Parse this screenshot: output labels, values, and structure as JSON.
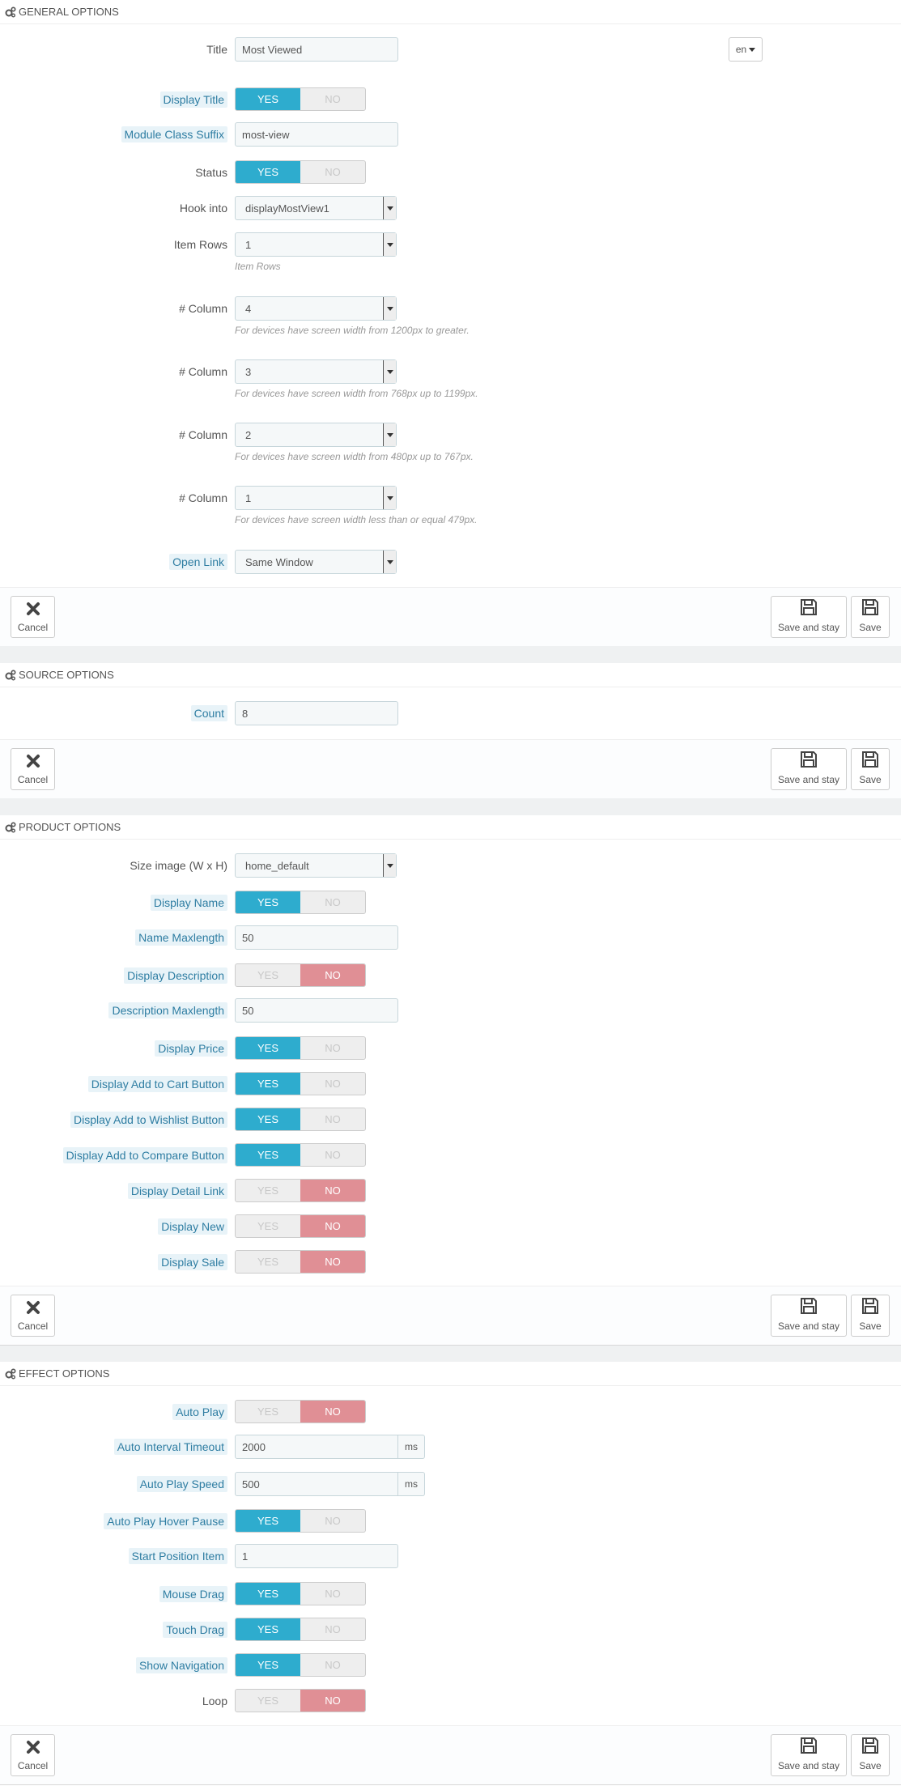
{
  "footer": {
    "cancel": "Cancel",
    "save_and_stay": "Save and stay",
    "save": "Save"
  },
  "switch_labels": {
    "yes": "YES",
    "no": "NO"
  },
  "general": {
    "heading": "GENERAL OPTIONS",
    "title_label": "Title",
    "title_value": "Most Viewed",
    "lang": "en",
    "display_title_label": "Display Title",
    "display_title": "yes",
    "suffix_label": "Module Class Suffix",
    "suffix_value": "most-view",
    "status_label": "Status",
    "status": "yes",
    "hook_label": "Hook into",
    "hook_value": "displayMostView1",
    "rows_label": "Item Rows",
    "rows_value": "1",
    "rows_help": "Item Rows",
    "col_label": "# Column",
    "col1_value": "4",
    "col1_help": "For devices have screen width from 1200px to greater.",
    "col2_value": "3",
    "col2_help": "For devices have screen width from 768px up to 1199px.",
    "col3_value": "2",
    "col3_help": "For devices have screen width from 480px up to 767px.",
    "col4_value": "1",
    "col4_help": "For devices have screen width less than or equal 479px.",
    "open_link_label": "Open Link",
    "open_link_value": "Same Window"
  },
  "source": {
    "heading": "SOURCE OPTIONS",
    "count_label": "Count",
    "count_value": "8"
  },
  "product": {
    "heading": "PRODUCT OPTIONS",
    "size_label": "Size image (W x H)",
    "size_value": "home_default",
    "display_name_label": "Display Name",
    "display_name": "yes",
    "name_maxlength_label": "Name Maxlength",
    "name_maxlength_value": "50",
    "display_desc_label": "Display Description",
    "display_desc": "no",
    "desc_maxlength_label": "Description Maxlength",
    "desc_maxlength_value": "50",
    "display_price_label": "Display Price",
    "display_price": "yes",
    "add_cart_label": "Display Add to Cart Button",
    "add_cart": "yes",
    "add_wishlist_label": "Display Add to Wishlist Button",
    "add_wishlist": "yes",
    "add_compare_label": "Display Add to Compare Button",
    "add_compare": "yes",
    "detail_link_label": "Display Detail Link",
    "detail_link": "no",
    "display_new_label": "Display New",
    "display_new": "no",
    "display_sale_label": "Display Sale",
    "display_sale": "no"
  },
  "effect": {
    "heading": "EFFECT OPTIONS",
    "auto_play_label": "Auto Play",
    "auto_play": "no",
    "interval_label": "Auto Interval Timeout",
    "interval_value": "2000",
    "interval_unit": "ms",
    "speed_label": "Auto Play Speed",
    "speed_value": "500",
    "speed_unit": "ms",
    "hover_pause_label": "Auto Play Hover Pause",
    "hover_pause": "yes",
    "start_pos_label": "Start Position Item",
    "start_pos_value": "1",
    "mouse_drag_label": "Mouse Drag",
    "mouse_drag": "yes",
    "touch_drag_label": "Touch Drag",
    "touch_drag": "yes",
    "show_nav_label": "Show Navigation",
    "show_nav": "yes",
    "loop_label": "Loop",
    "loop": "no"
  },
  "icons": {
    "section": "cogs-icon",
    "cancel": "close-icon",
    "save": "floppy-disk-icon"
  }
}
